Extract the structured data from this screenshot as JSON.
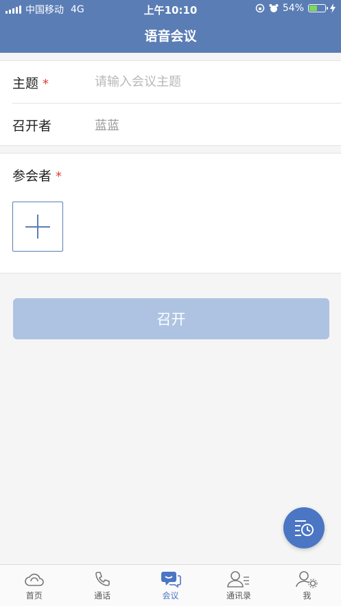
{
  "status_bar": {
    "carrier": "中国移动",
    "network": "4G",
    "time": "上午10:10",
    "battery_percent": "54%",
    "battery_level": 0.54
  },
  "nav": {
    "title": "语音会议"
  },
  "form": {
    "subject_label": "主题",
    "subject_required_mark": "*",
    "subject_placeholder": "请输入会议主题",
    "host_label": "召开者",
    "host_value": "蓝蓝",
    "participants_label": "参会者",
    "participants_required_mark": "*"
  },
  "open_button_label": "召开",
  "tabs": [
    {
      "label": "首页",
      "icon": "home-cloud-icon"
    },
    {
      "label": "通话",
      "icon": "phone-icon"
    },
    {
      "label": "会议",
      "icon": "meeting-chat-icon"
    },
    {
      "label": "通讯录",
      "icon": "contacts-icon"
    },
    {
      "label": "我",
      "icon": "profile-settings-icon"
    }
  ],
  "active_tab": "会议",
  "colors": {
    "header": "#5a7db5",
    "accent": "#4a76c3",
    "button_disabled": "#aec3e2",
    "required": "#e23b3b"
  }
}
